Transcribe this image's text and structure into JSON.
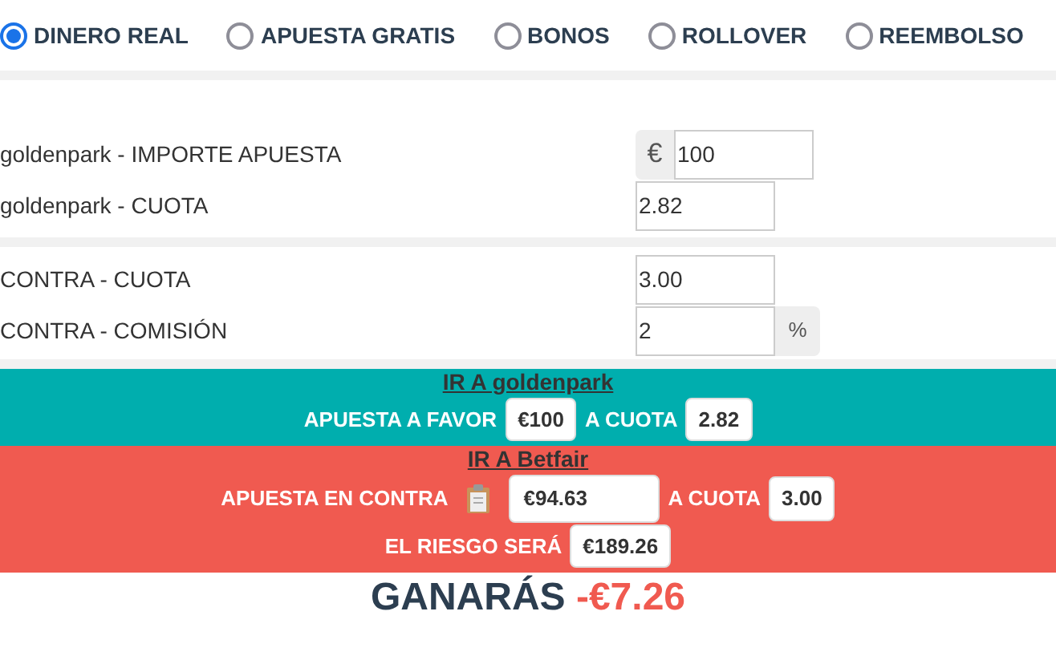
{
  "bet_types": [
    {
      "label": "DINERO REAL",
      "selected": true
    },
    {
      "label": "APUESTA GRATIS",
      "selected": false
    },
    {
      "label": "BONOS",
      "selected": false
    },
    {
      "label": "ROLLOVER",
      "selected": false
    },
    {
      "label": "REEMBOLSO",
      "selected": false
    }
  ],
  "sections": [
    {
      "fields": [
        {
          "label": "goldenpark - IMPORTE APUESTA",
          "value": "100",
          "prefix": "€"
        },
        {
          "label": "goldenpark - CUOTA",
          "value": "2.82"
        }
      ]
    },
    {
      "fields": [
        {
          "label": "CONTRA - CUOTA",
          "value": "3.00"
        },
        {
          "label": "CONTRA - COMISIÓN",
          "value": "2",
          "suffix": "%"
        }
      ]
    }
  ],
  "panels": [
    {
      "kind": "back",
      "link": "IR A goldenpark",
      "lines": [
        [
          {
            "kind": "text",
            "text": "APUESTA A FAVOR"
          },
          {
            "kind": "value",
            "text": "€100"
          },
          {
            "kind": "text",
            "text": "A CUOTA"
          },
          {
            "kind": "value",
            "text": "2.82"
          }
        ]
      ]
    },
    {
      "kind": "lay",
      "link": "IR A Betfair",
      "lines": [
        [
          {
            "kind": "text",
            "text": "APUESTA EN CONTRA"
          },
          {
            "kind": "copy"
          },
          {
            "kind": "field",
            "text": "€94.63"
          },
          {
            "kind": "text",
            "text": "A CUOTA"
          },
          {
            "kind": "value",
            "text": "3.00"
          }
        ],
        [
          {
            "kind": "text",
            "text": "EL RIESGO SERÁ"
          },
          {
            "kind": "value",
            "text": "€189.26"
          }
        ]
      ]
    }
  ],
  "result": {
    "label": "GANARÁS",
    "amount": "-€7.26"
  }
}
